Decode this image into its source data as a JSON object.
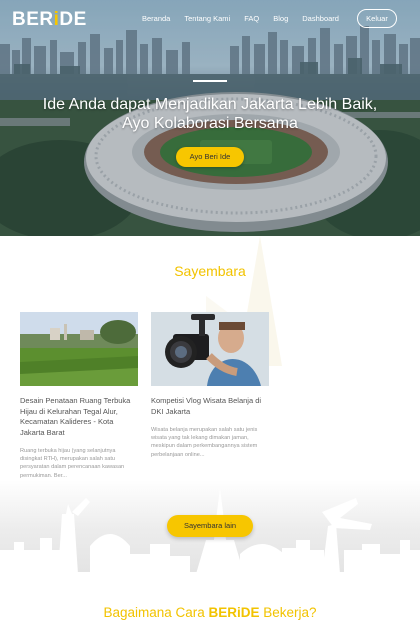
{
  "brand": {
    "name": "BERiDE"
  },
  "nav": {
    "links": [
      "Beranda",
      "Tentang Kami",
      "FAQ",
      "Blog",
      "Dashboard"
    ],
    "logout_label": "Keluar"
  },
  "hero": {
    "title_line1": "Ide Anda dapat Menjadikan Jakarta Lebih Baik,",
    "title_line2": "Ayo Kolaborasi Bersama",
    "cta_label": "Ayo Beri Ide"
  },
  "sayembara": {
    "title": "Sayembara",
    "cards": [
      {
        "title": "Desain Penataan Ruang Terbuka Hijau di Kelurahan Tegal Alur, Kecamatan Kalideres - Kota Jakarta Barat",
        "description": "Ruang terbuka hijau (yang selanjutnya disingkat RTH), merupakan salah satu persyaratan dalam perencanaan kawasan permukiman. Ber..."
      },
      {
        "title": "Kompetisi Vlog Wisata Belanja di DKI Jakarta",
        "description": "Wisata belanja merupakan salah satu jenis wisata yang tak lekang dimakan jaman, meskipun dalam perkembangannya sistem perbelanjaan online..."
      }
    ],
    "more_label": "Sayembara lain"
  },
  "how": {
    "title_prefix": "Bagaimana Cara ",
    "title_brand": "BERiDE",
    "title_suffix": " Bekerja?"
  },
  "colors": {
    "accent": "#f7c600",
    "accent_text": "#f2c300"
  }
}
